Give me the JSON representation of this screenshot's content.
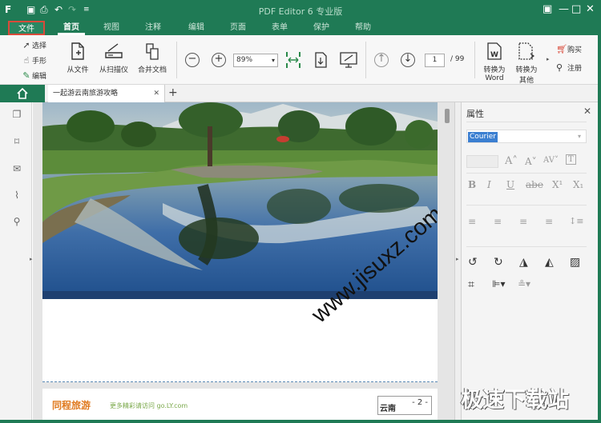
{
  "window": {
    "title": "PDF Editor 6 专业版",
    "colors": {
      "brand": "#1f7a55",
      "file_tab_border": "#d94a3a"
    }
  },
  "quick_access": [
    "app-icon",
    "save-icon",
    "print-icon",
    "undo-icon",
    "redo-icon",
    "customize-icon"
  ],
  "ribbon_tabs": [
    {
      "label": "文件",
      "active": false
    },
    {
      "label": "首页",
      "active": true
    },
    {
      "label": "视图"
    },
    {
      "label": "注释"
    },
    {
      "label": "编辑"
    },
    {
      "label": "页面"
    },
    {
      "label": "表单"
    },
    {
      "label": "保护"
    },
    {
      "label": "帮助"
    }
  ],
  "toolbar": {
    "select": "选择",
    "hand": "手形",
    "edit": "编辑",
    "from_file": "从文件",
    "from_scanner": "从扫描仪",
    "merge": "合并文档",
    "zoom": "89%",
    "page_current": "1",
    "page_total": "/ 99",
    "to_word_1": "转换为",
    "to_word_2": "Word",
    "to_other_1": "转换为",
    "to_other_2": "其他",
    "buy": "购买",
    "register": "注册"
  },
  "doc_tab": {
    "title": "一起游云南旅游攻略"
  },
  "document": {
    "watermark": "www.jisuxz.com",
    "page2_brand": "同程旅游",
    "page2_brand_sub": "更多精彩请访问 go.LY.com",
    "page2_text": "云南",
    "page2_pagenum": "- 2 -"
  },
  "properties": {
    "title": "属性",
    "font": "Courier"
  },
  "site_logo": "极速下载站"
}
